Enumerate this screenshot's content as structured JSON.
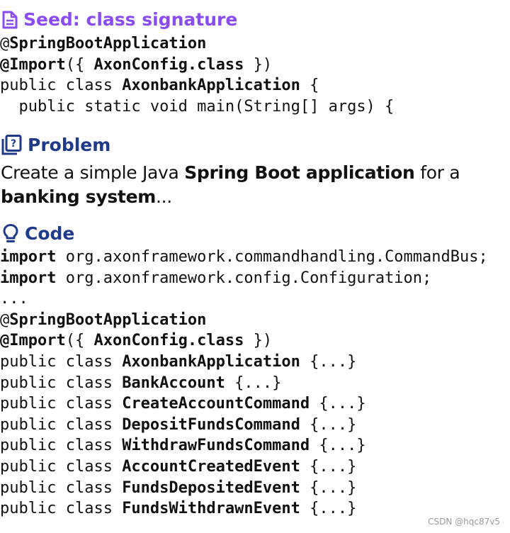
{
  "seed": {
    "heading": "Seed: class signature",
    "lines": [
      [
        {
          "t": "@",
          "b": false
        },
        {
          "t": "SpringBootApplication",
          "b": true
        }
      ],
      [
        {
          "t": "@Import",
          "b": true
        },
        {
          "t": "({ ",
          "b": false
        },
        {
          "t": "AxonConfig.class",
          "b": true
        },
        {
          "t": " })",
          "b": false
        }
      ],
      [
        {
          "t": "public class ",
          "b": false
        },
        {
          "t": "AxonbankApplication",
          "b": true
        },
        {
          "t": " {",
          "b": false
        }
      ],
      [
        {
          "t": "  public static void main(String[] args) {",
          "b": false
        }
      ]
    ]
  },
  "problem": {
    "heading": "Problem",
    "parts": [
      {
        "t": "Create a simple Java ",
        "b": false
      },
      {
        "t": "Spring Boot application",
        "b": true
      },
      {
        "t": " for a ",
        "b": false
      },
      {
        "t": "banking system",
        "b": true
      },
      {
        "t": "...",
        "b": false
      }
    ]
  },
  "code": {
    "heading": "Code",
    "lines": [
      [
        {
          "t": "import",
          "b": true
        },
        {
          "t": " org.axonframework.commandhandling.CommandBus;",
          "b": false
        }
      ],
      [
        {
          "t": "import",
          "b": true
        },
        {
          "t": " org.axonframework.config.Configuration;",
          "b": false
        }
      ],
      [
        {
          "t": "...",
          "b": false
        }
      ],
      [
        {
          "t": "@",
          "b": false
        },
        {
          "t": "SpringBootApplication",
          "b": true
        }
      ],
      [
        {
          "t": "@Import",
          "b": true
        },
        {
          "t": "({ ",
          "b": false
        },
        {
          "t": "AxonConfig.class",
          "b": true
        },
        {
          "t": " })",
          "b": false
        }
      ],
      [
        {
          "t": "public class ",
          "b": false
        },
        {
          "t": "AxonbankApplication",
          "b": true
        },
        {
          "t": " {...}",
          "b": false
        }
      ],
      [
        {
          "t": "public class ",
          "b": false
        },
        {
          "t": "BankAccount",
          "b": true
        },
        {
          "t": " {...}",
          "b": false
        }
      ],
      [
        {
          "t": "public class ",
          "b": false
        },
        {
          "t": "CreateAccountCommand",
          "b": true
        },
        {
          "t": " {...}",
          "b": false
        }
      ],
      [
        {
          "t": "public class ",
          "b": false
        },
        {
          "t": "DepositFundsCommand",
          "b": true
        },
        {
          "t": " {...}",
          "b": false
        }
      ],
      [
        {
          "t": "public class ",
          "b": false
        },
        {
          "t": "WithdrawFundsCommand",
          "b": true
        },
        {
          "t": " {...}",
          "b": false
        }
      ],
      [
        {
          "t": "public class ",
          "b": false
        },
        {
          "t": "AccountCreatedEvent",
          "b": true
        },
        {
          "t": " {...}",
          "b": false
        }
      ],
      [
        {
          "t": "public class ",
          "b": false
        },
        {
          "t": "FundsDepositedEvent",
          "b": true
        },
        {
          "t": " {...}",
          "b": false
        }
      ],
      [
        {
          "t": "public class ",
          "b": false
        },
        {
          "t": "FundsWithdrawnEvent",
          "b": true
        },
        {
          "t": " {...}",
          "b": false
        }
      ]
    ]
  },
  "watermark": "CSDN @hqc87v5",
  "colors": {
    "seed_heading": "#8a4cf0",
    "section_heading": "#1e3a8a"
  },
  "icons": {
    "seed": "document-icon",
    "problem": "question-book-icon",
    "code": "lightbulb-icon"
  }
}
